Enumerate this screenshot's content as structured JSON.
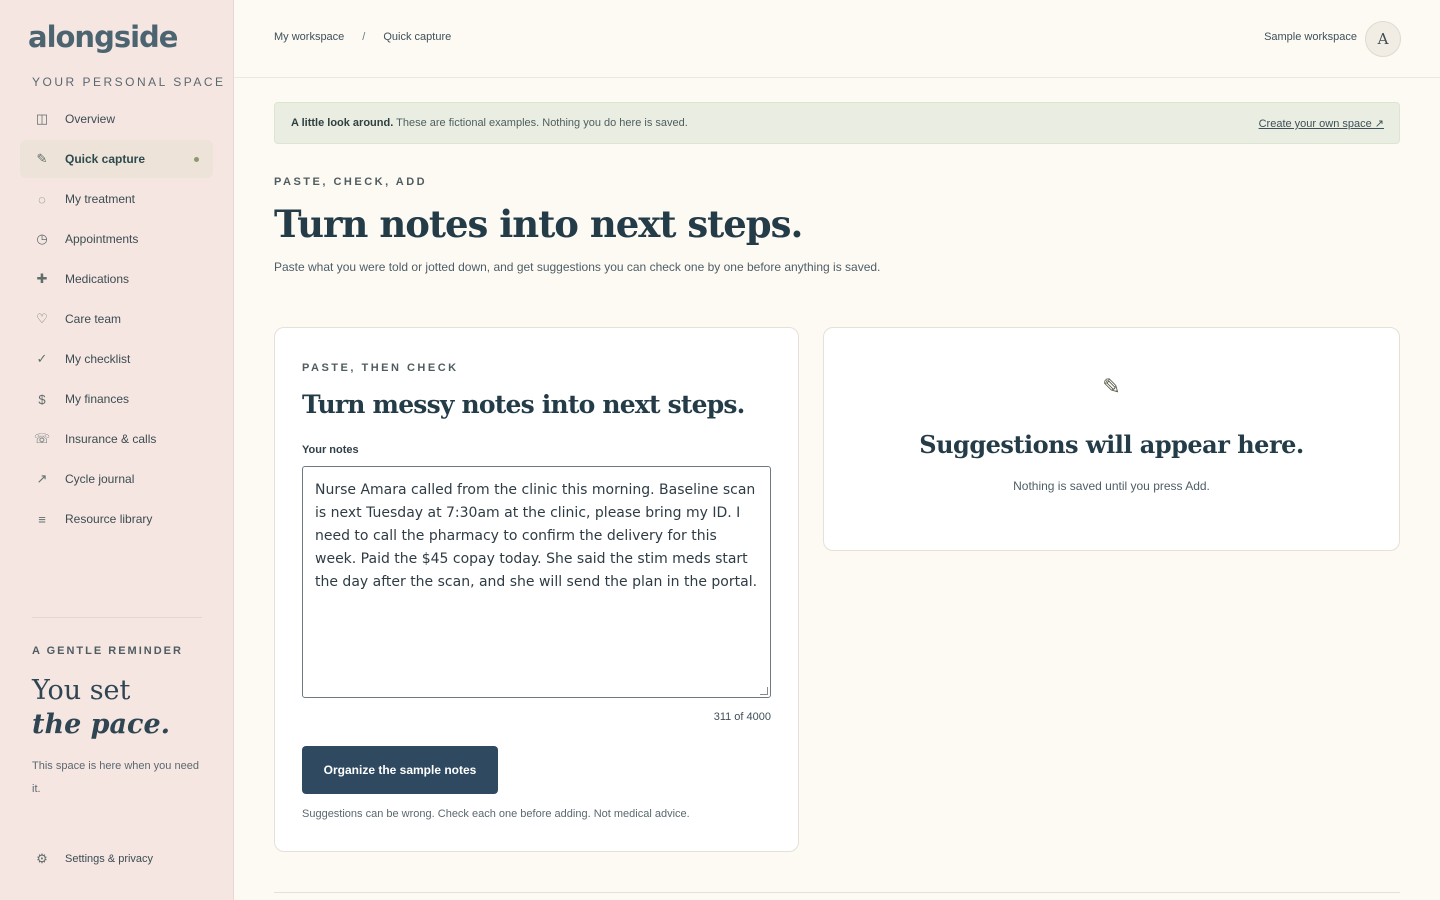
{
  "brand": "alongside",
  "sidebar": {
    "section_label": "YOUR PERSONAL SPACE",
    "items": [
      {
        "label": "Overview",
        "icon": "◫"
      },
      {
        "label": "Quick capture",
        "icon": "✎",
        "active": true
      },
      {
        "label": "My treatment",
        "icon": "◌"
      },
      {
        "label": "Appointments",
        "icon": "◷"
      },
      {
        "label": "Medications",
        "icon": "✚"
      },
      {
        "label": "Care team",
        "icon": "♡"
      },
      {
        "label": "My checklist",
        "icon": "✓"
      },
      {
        "label": "My finances",
        "icon": "$"
      },
      {
        "label": "Insurance & calls",
        "icon": "☏"
      },
      {
        "label": "Cycle journal",
        "icon": "↗"
      },
      {
        "label": "Resource library",
        "icon": "≡"
      }
    ],
    "reminder_title": "A GENTLE REMINDER",
    "reminder_line1": "You set",
    "reminder_line2": "the pace.",
    "reminder_text": "This space is here when you need it.",
    "settings_label": "Settings & privacy",
    "settings_icon": "⚙"
  },
  "header": {
    "breadcrumb": [
      "My workspace",
      "/",
      "Quick capture"
    ],
    "workspace_label": "Sample workspace",
    "avatar_initial": "A"
  },
  "banner": {
    "bold": "A little look around.",
    "text": " These are fictional examples. Nothing you do here is saved.",
    "link": "Create your own space ↗"
  },
  "hero": {
    "eyebrow": "PASTE, CHECK, ADD",
    "title": "Turn notes into next steps.",
    "subtitle": "Paste what you were told or jotted down, and get suggestions you can check one by one before anything is saved."
  },
  "capture_card": {
    "eyebrow": "PASTE, THEN CHECK",
    "title": "Turn messy notes into next steps.",
    "notes_label": "Your notes",
    "notes_value": "Nurse Amara called from the clinic this morning. Baseline scan is next Tuesday at 7:30am at the clinic, please bring my ID. I need to call the pharmacy to confirm the delivery for this week. Paid the $45 copay today. She said the stim meds start the day after the scan, and she will send the plan in the portal.",
    "char_count": "311 of 4000",
    "button_label": "Organize the sample notes",
    "disclaimer": "Suggestions can be wrong. Check each one before adding. Not medical advice."
  },
  "suggestions_card": {
    "icon": "✎",
    "title": "Suggestions will appear here.",
    "subtitle": "Nothing is saved until you press Add."
  }
}
